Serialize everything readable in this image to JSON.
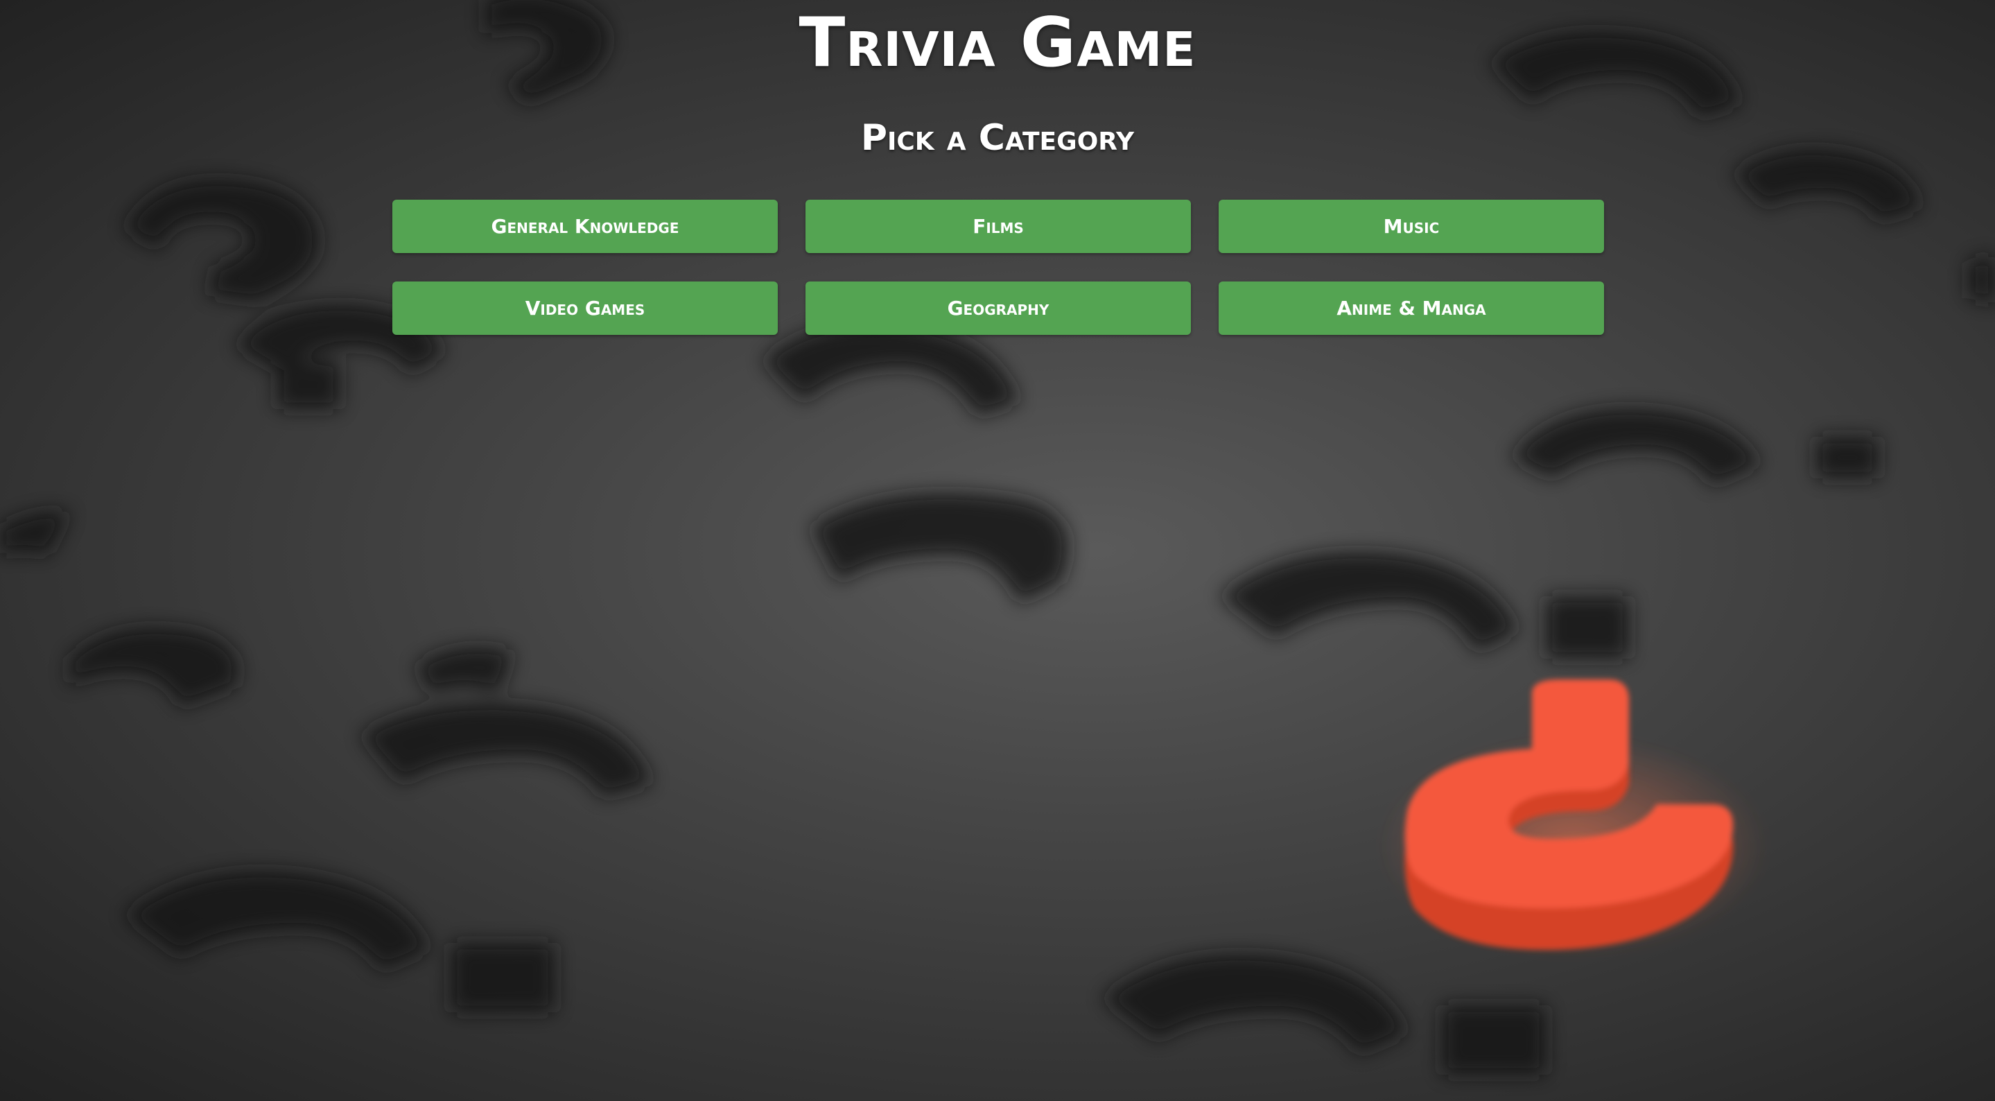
{
  "header": {
    "title": "Trivia Game",
    "subtitle": "Pick a Category"
  },
  "categories": [
    {
      "label": "General Knowledge"
    },
    {
      "label": "Films"
    },
    {
      "label": "Music"
    },
    {
      "label": "Video Games"
    },
    {
      "label": "Geography"
    },
    {
      "label": "Anime & Manga"
    }
  ],
  "colors": {
    "button_bg": "#54a452",
    "text": "#ffffff",
    "background": "#3c3c3c",
    "accent_question_mark": "#f0553a"
  }
}
